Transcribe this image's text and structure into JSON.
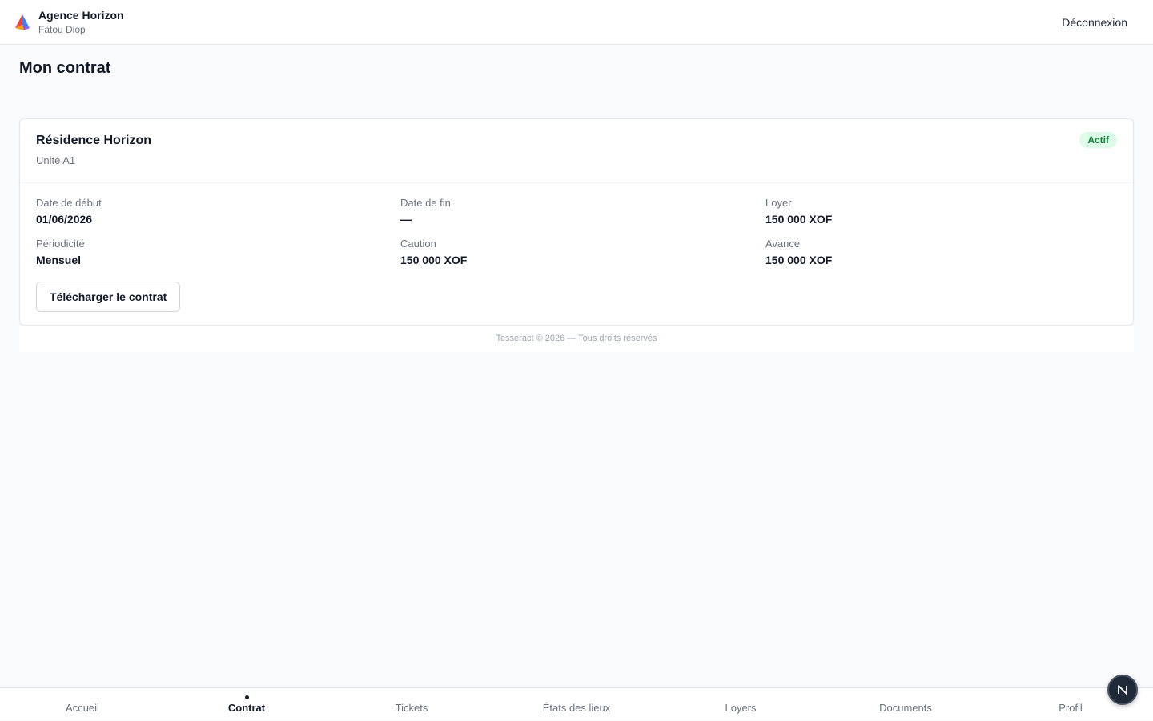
{
  "header": {
    "brand_name": "Agence Horizon",
    "user_name": "Fatou Diop",
    "logout_label": "Déconnexion"
  },
  "page": {
    "title": "Mon contrat"
  },
  "contract": {
    "property": "Résidence Horizon",
    "unit": "Unité A1",
    "status": "Actif",
    "fields": [
      {
        "label": "Date de début",
        "value": "01/06/2026"
      },
      {
        "label": "Date de fin",
        "value": "—"
      },
      {
        "label": "Loyer",
        "value": "150 000 XOF"
      },
      {
        "label": "Périodicité",
        "value": "Mensuel"
      },
      {
        "label": "Caution",
        "value": "150 000 XOF"
      },
      {
        "label": "Avance",
        "value": "150 000 XOF"
      }
    ],
    "download_label": "Télécharger le contrat"
  },
  "footer": {
    "text": "Tesseract © 2026 — Tous droits réservés"
  },
  "bottom_nav": {
    "items": [
      {
        "label": "Accueil"
      },
      {
        "label": "Contrat"
      },
      {
        "label": "Tickets"
      },
      {
        "label": "États des lieux"
      },
      {
        "label": "Loyers"
      },
      {
        "label": "Documents"
      },
      {
        "label": "Profil"
      }
    ],
    "active": "Contrat"
  },
  "fab": {
    "icon": "n-logo-icon"
  },
  "colors": {
    "badge_bg": "#dcfce7",
    "badge_text": "#15803d",
    "page_bg": "#f8fafc"
  }
}
